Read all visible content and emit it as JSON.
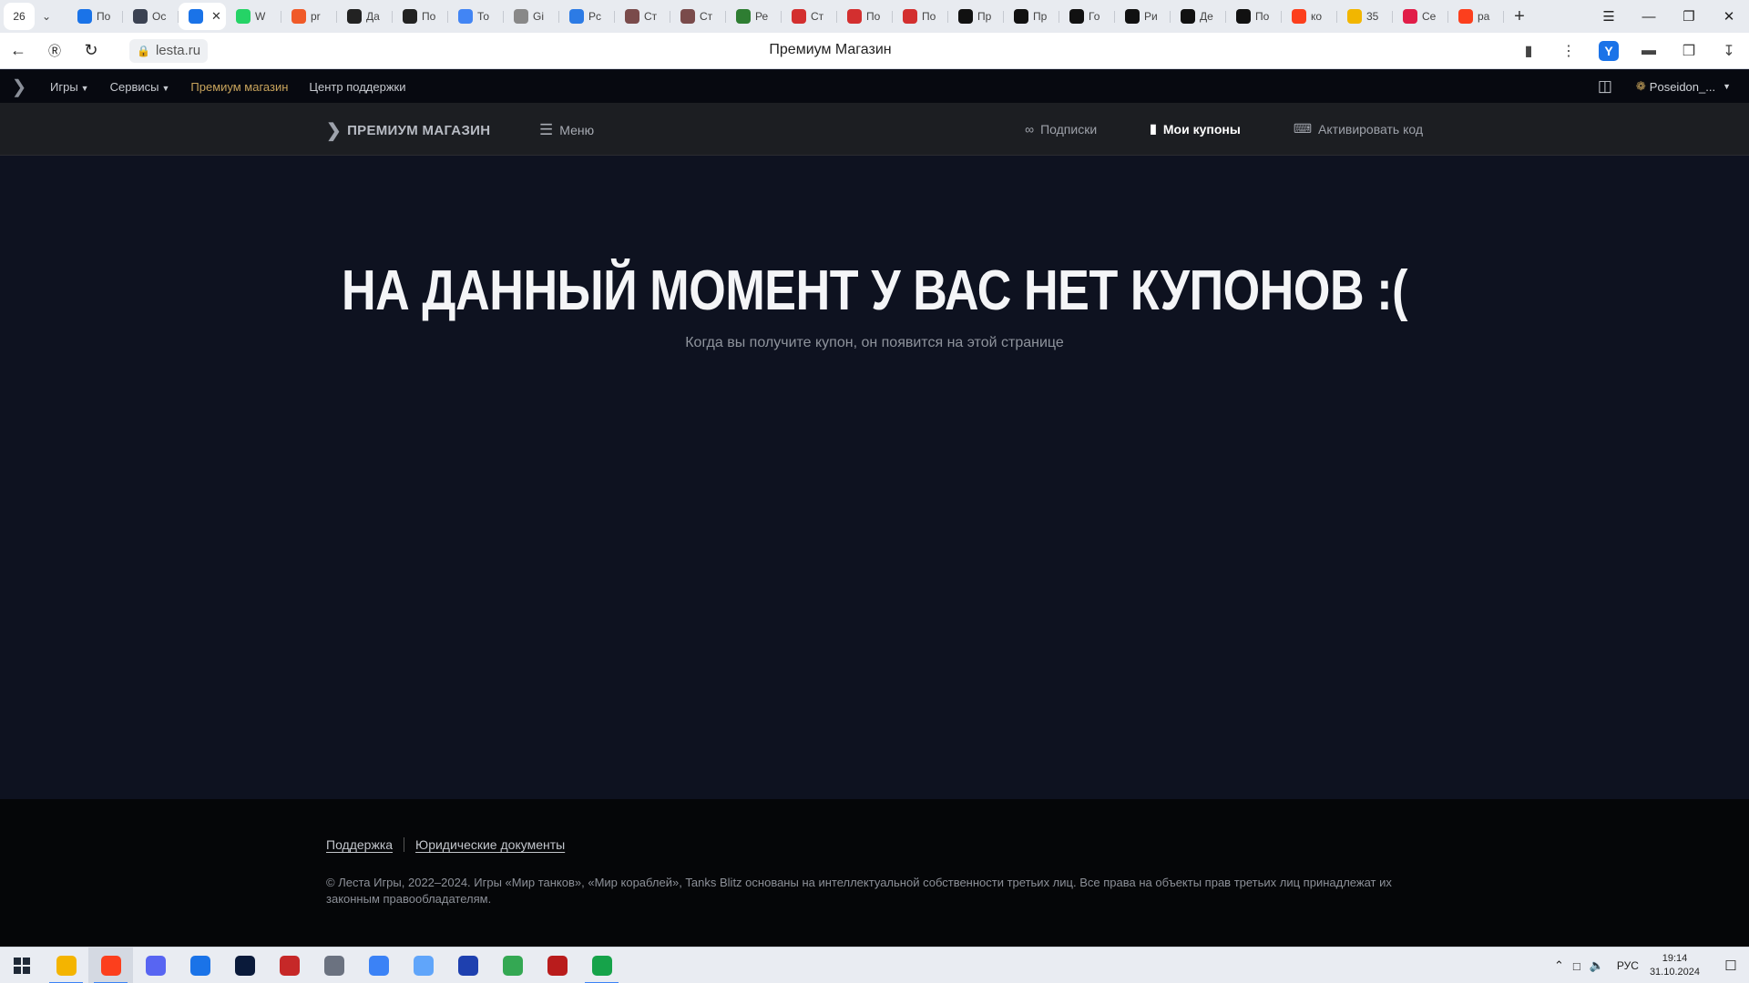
{
  "browser": {
    "tab_counter": "26",
    "tabs": [
      {
        "label": "По",
        "icon": "mail-icon",
        "color": "#1a73e8"
      },
      {
        "label": "Ос",
        "icon": "shield-icon",
        "color": "#3b4252"
      },
      {
        "label": "",
        "icon": "lesta-icon",
        "color": "#1a73e8",
        "active": true
      },
      {
        "label": "W",
        "icon": "whatsapp-icon",
        "color": "#25d366"
      },
      {
        "label": "pr",
        "icon": "app-icon",
        "color": "#f05a28"
      },
      {
        "label": "Да",
        "icon": "plus-dark-icon",
        "color": "#222222"
      },
      {
        "label": "По",
        "icon": "plus-dark-icon",
        "color": "#222222"
      },
      {
        "label": "То",
        "icon": "google-icon",
        "color": "#4285f4"
      },
      {
        "label": "Gi",
        "icon": "octocat-icon",
        "color": "#888888"
      },
      {
        "label": "Рс",
        "icon": "circle-p-icon",
        "color": "#2c7be5"
      },
      {
        "label": "Ст",
        "icon": "avatar-icon",
        "color": "#7a4b4b"
      },
      {
        "label": "Ст",
        "icon": "avatar-icon",
        "color": "#7a4b4b"
      },
      {
        "label": "Ре",
        "icon": "emblem-icon",
        "color": "#2e7d32"
      },
      {
        "label": "Ст",
        "icon": "flag-icon",
        "color": "#d32f2f"
      },
      {
        "label": "По",
        "icon": "flag-icon",
        "color": "#d32f2f"
      },
      {
        "label": "По",
        "icon": "flag-icon",
        "color": "#d32f2f"
      },
      {
        "label": "Пр",
        "icon": "wt-icon",
        "color": "#111111"
      },
      {
        "label": "Пр",
        "icon": "wt-icon",
        "color": "#111111"
      },
      {
        "label": "Го",
        "icon": "wt-icon",
        "color": "#111111"
      },
      {
        "label": "Ри",
        "icon": "wt-icon",
        "color": "#111111"
      },
      {
        "label": "Де",
        "icon": "wt-icon",
        "color": "#111111"
      },
      {
        "label": "По",
        "icon": "wt-icon",
        "color": "#111111"
      },
      {
        "label": "ко",
        "icon": "yandex-icon",
        "color": "#fc3f1d"
      },
      {
        "label": "35",
        "icon": "mail-envelope-icon",
        "color": "#f2b600"
      },
      {
        "label": "Се",
        "icon": "circle-app-icon",
        "color": "#e11d48"
      },
      {
        "label": "ра",
        "icon": "yandex-icon",
        "color": "#fc3f1d"
      }
    ],
    "url": "lesta.ru",
    "page_title": "Премиум Магазин"
  },
  "site_nav": {
    "games": "Игры",
    "services": "Сервисы",
    "premium": "Премиум магазин",
    "support": "Центр поддержки",
    "username": "Poseidon_..."
  },
  "store_header": {
    "brand": "ПРЕМИУМ МАГАЗИН",
    "menu": "Меню",
    "links": {
      "subscriptions": "Подписки",
      "coupons": "Мои купоны",
      "activate": "Активировать код"
    }
  },
  "main": {
    "title": "НА ДАННЫЙ МОМЕНТ У ВАС НЕТ КУПОНОВ :(",
    "subtitle": "Когда вы получите купон, он появится на этой странице"
  },
  "footer": {
    "support": "Поддержка",
    "legal": "Юридические документы",
    "copyright": "© Леста Игры, 2022–2024. Игры «Мир танков», «Мир кораблей», Tanks Blitz основаны на интеллектуальной собственности третьих лиц. Все права на объекты прав третьих лиц принадлежат их законным правообладателям."
  },
  "taskbar": {
    "apps": [
      {
        "name": "file-explorer-icon",
        "color": "#f4b400",
        "running": true
      },
      {
        "name": "yandex-browser-icon",
        "color": "#fc3f1d",
        "running": true,
        "active": true
      },
      {
        "name": "discord-icon",
        "color": "#5865f2"
      },
      {
        "name": "lesta-launcher-icon",
        "color": "#1a73e8"
      },
      {
        "name": "photoshop-icon",
        "color": "#0a1a3a"
      },
      {
        "name": "red-app-icon",
        "color": "#c62828"
      },
      {
        "name": "game-icon",
        "color": "#6b7280"
      },
      {
        "name": "paint-icon",
        "color": "#3b82f6"
      },
      {
        "name": "notepad-icon",
        "color": "#60a5fa"
      },
      {
        "name": "wot-blue-icon",
        "color": "#1e40af"
      },
      {
        "name": "chrome-icon",
        "color": "#34a853"
      },
      {
        "name": "game-char-icon",
        "color": "#b91c1c"
      },
      {
        "name": "torrent-icon",
        "color": "#16a34a",
        "running": true
      }
    ],
    "language": "РУС",
    "time": "19:14",
    "date": "31.10.2024"
  }
}
